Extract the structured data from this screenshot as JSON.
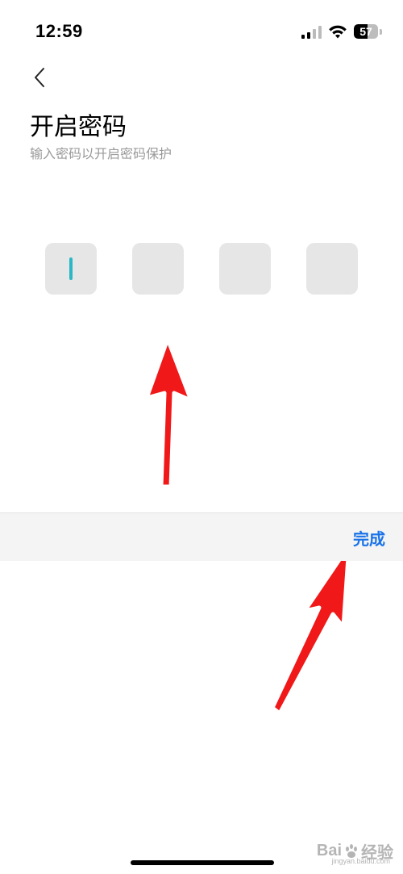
{
  "status_bar": {
    "time": "12:59",
    "battery_level": "57",
    "battery_fraction": 0.57
  },
  "header": {
    "back_icon": "chevron-left-icon",
    "title": "开启密码",
    "subtitle": "输入密码以开启密码保护"
  },
  "pin": {
    "length": 4,
    "filled": 0,
    "cursor_color": "#2bb8c6"
  },
  "keyboard_toolbar": {
    "done_label": "完成",
    "done_color": "#1a73e8"
  },
  "annotation": {
    "arrow_color": "#f01818"
  },
  "watermark": {
    "brand": "Bai",
    "brand_suffix": "经验",
    "site": "jingyan.baidu.com"
  }
}
